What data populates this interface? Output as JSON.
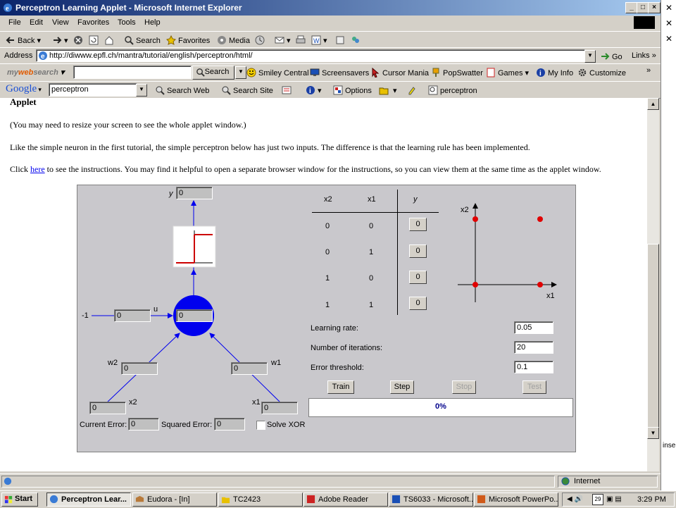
{
  "window": {
    "title": "Perceptron Learning Applet - Microsoft Internet Explorer"
  },
  "menu": [
    "File",
    "Edit",
    "View",
    "Favorites",
    "Tools",
    "Help"
  ],
  "toolbar": {
    "back": "Back",
    "search": "Search",
    "favorites": "Favorites",
    "media": "Media"
  },
  "address": {
    "label": "Address",
    "url": "http://diwww.epfl.ch/mantra/tutorial/english/perceptron/html/",
    "go": "Go",
    "links": "Links"
  },
  "mywebsearch": {
    "logo_my": "my",
    "logo_web": "web",
    "logo_search": "search",
    "search_btn": "Search",
    "items": [
      "Smiley Central",
      "Screensavers",
      "Cursor Mania",
      "PopSwatter",
      "Games",
      "My Info",
      "Customize"
    ]
  },
  "google": {
    "logo": "Google",
    "query": "perceptron",
    "search_web": "Search Web",
    "search_site": "Search Site",
    "options": "Options",
    "term": "perceptron"
  },
  "page": {
    "heading": "Applet",
    "para1": "(You may need to resize your screen to see the whole applet window.)",
    "para2": "Like the simple neuron in the first tutorial, the simple perceptron below has just two inputs.  The difference is that the learning rule has been implemented.",
    "para3_pre": "Click ",
    "para3_link": "here",
    "para3_post": " to see the instructions.  You may find it helpful to open a separate browser window for the instructions, so you can view them at the same time as the applet window."
  },
  "applet": {
    "y_label": "y",
    "y_value": "0",
    "bias_label": "-1",
    "bias_value": "0",
    "u_label": "u",
    "u_value": "0",
    "w2_label": "w2",
    "w2_value": "0",
    "w1_label": "w1",
    "w1_value": "0",
    "x2_label": "x2",
    "x2_value": "0",
    "x1_label": "x1",
    "x1_value": "0",
    "current_error_label": "Current Error:",
    "current_error": "0",
    "squared_error_label": "Squared Error:",
    "squared_error": "0",
    "solve_xor_label": "Solve XOR",
    "truth_table": {
      "headers": [
        "x2",
        "x1",
        "y"
      ],
      "rows": [
        [
          "0",
          "0",
          "0"
        ],
        [
          "0",
          "1",
          "0"
        ],
        [
          "1",
          "0",
          "0"
        ],
        [
          "1",
          "1",
          "0"
        ]
      ]
    },
    "plot": {
      "x_label": "x1",
      "y_label": "x2",
      "point_color": "#e00000"
    },
    "learning_rate_label": "Learning rate:",
    "learning_rate": "0.05",
    "iterations_label": "Number of iterations:",
    "iterations": "20",
    "threshold_label": "Error threshold:",
    "threshold": "0.1",
    "buttons": {
      "train": "Train",
      "step": "Step",
      "stop": "Stop",
      "test": "Test"
    },
    "progress": {
      "text": "0%",
      "value": 0
    }
  },
  "status": {
    "zone": "Internet"
  },
  "taskbar": {
    "start": "Start",
    "tasks": [
      "Perceptron Lear...",
      "Eudora - [In]",
      "TC2423",
      "Adobe Reader",
      "TS6033 - Microsoft...",
      "Microsoft PowerPo..."
    ],
    "clock": "3:29 PM",
    "tray_date": "29"
  },
  "side_text": "inse"
}
